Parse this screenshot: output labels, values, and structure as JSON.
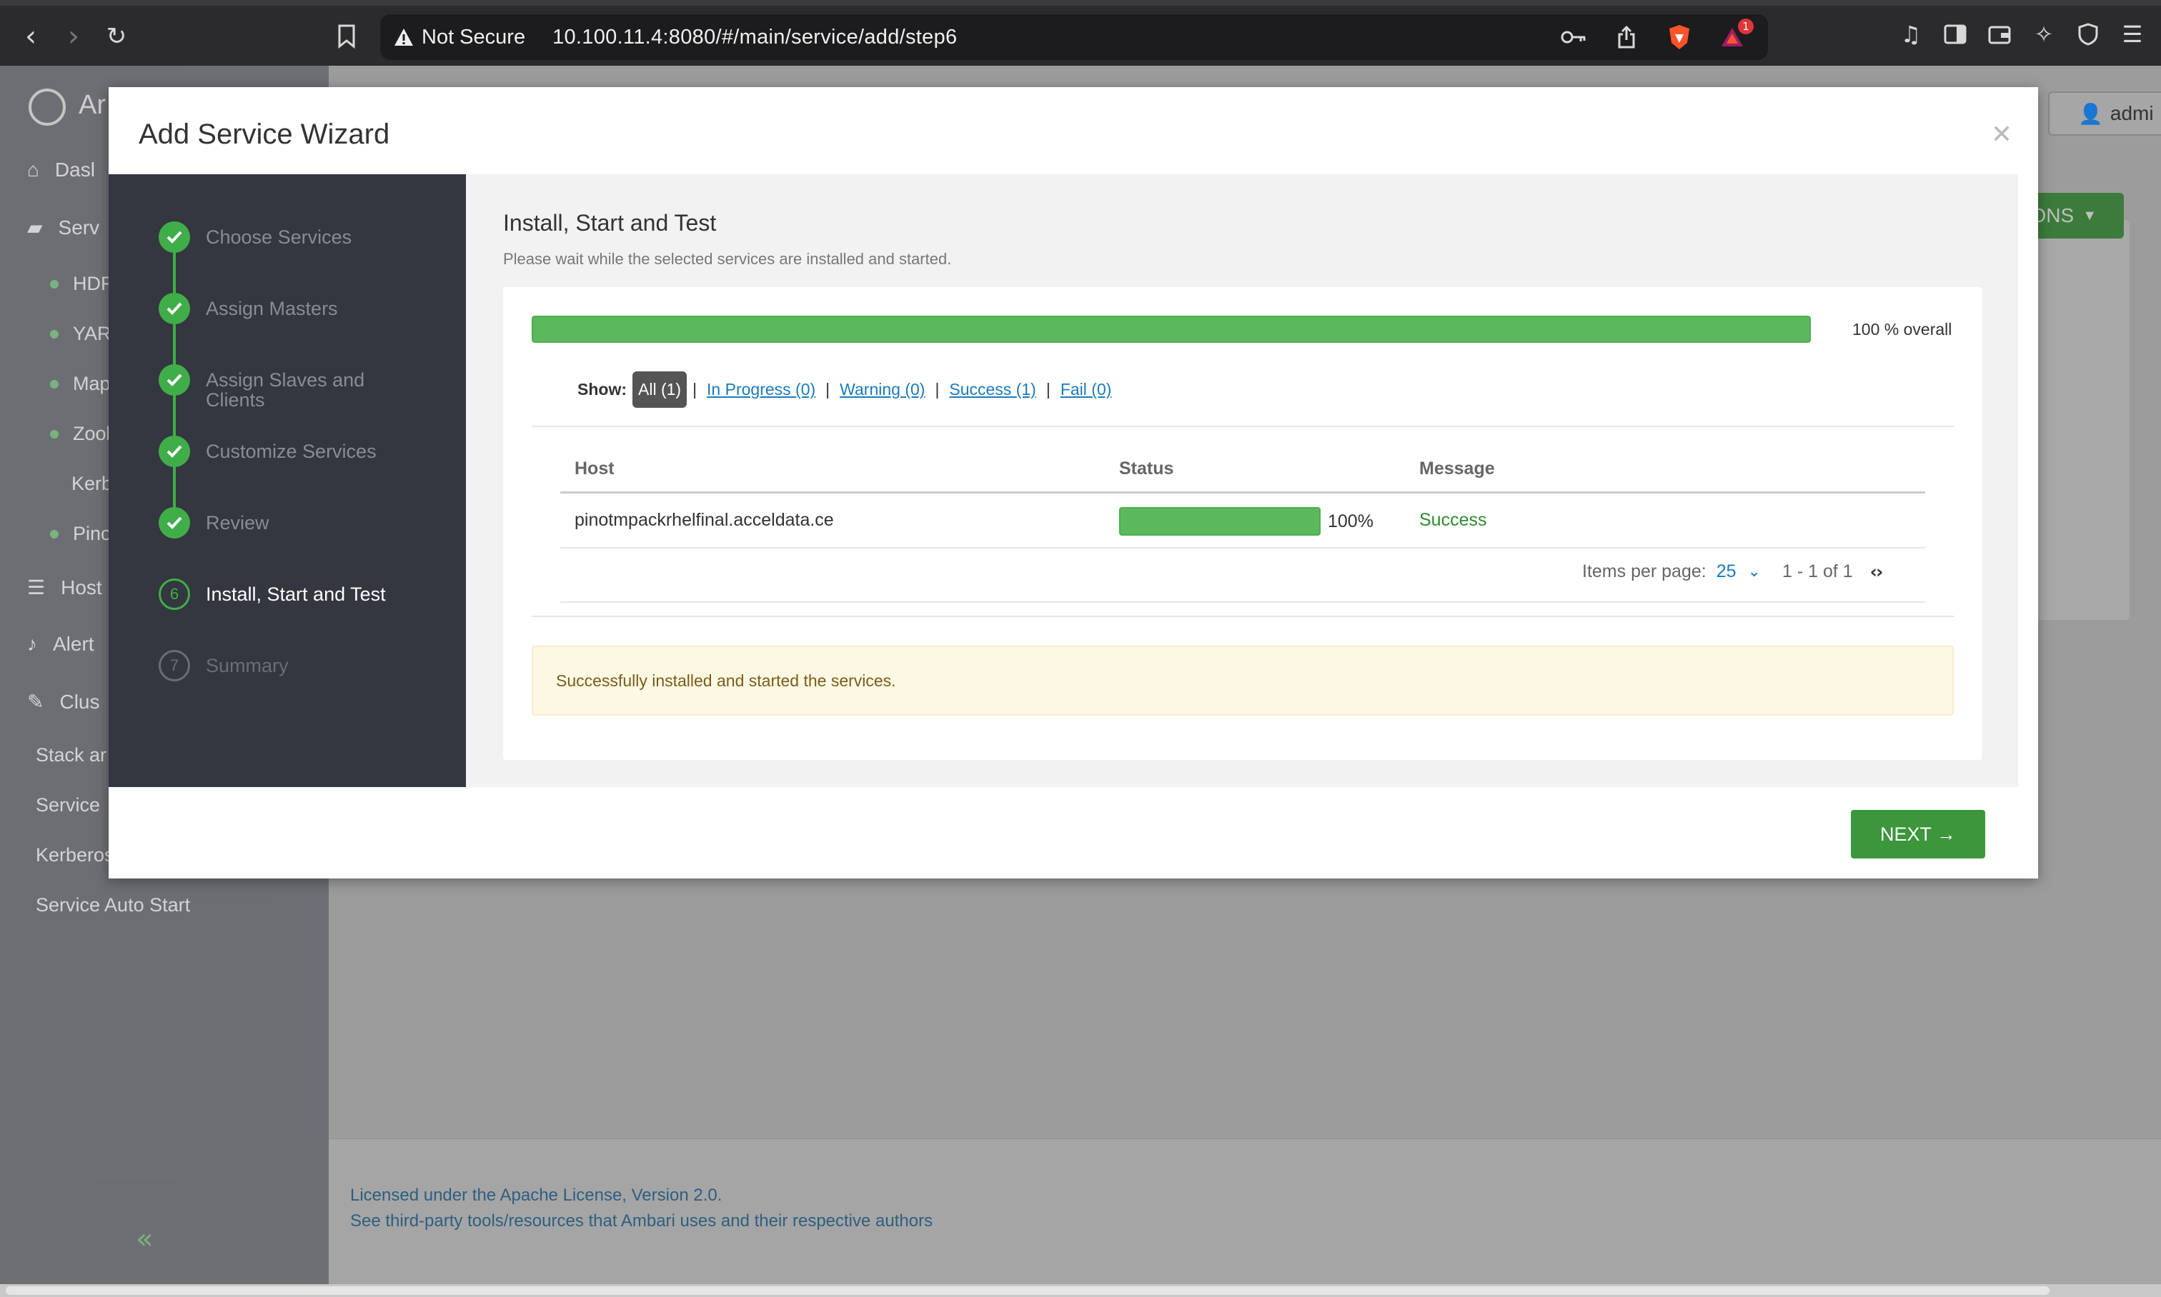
{
  "browser": {
    "not_secure": "Not Secure",
    "url": "10.100.11.4:8080/#/main/service/add/step6",
    "brave_badge": "1"
  },
  "app": {
    "brand": "Ar",
    "user_label": "admi",
    "actions_label": "ONS",
    "sidebar": {
      "dashboard": "Dasl",
      "services": "Serv",
      "service_items": [
        "HDF",
        "YARI",
        "Map",
        "Zool"
      ],
      "kerberos_sub": "Kerb",
      "pinot": "Pino",
      "hosts": "Host",
      "alerts": "Alert",
      "cluster": "Clus",
      "links": [
        "Stack ar",
        "Service",
        "Kerberos",
        "Service Auto Start"
      ]
    },
    "footer": {
      "license": "Licensed under the Apache License, Version 2.0.",
      "third_party": "See third-party tools/resources that Ambari uses and their respective authors"
    }
  },
  "wizard": {
    "title": "Add Service Wizard",
    "steps": [
      {
        "label": "Choose Services"
      },
      {
        "label": "Assign Masters"
      },
      {
        "label": "Assign Slaves and Clients"
      },
      {
        "label": "Customize Services"
      },
      {
        "label": "Review"
      },
      {
        "label": "Install, Start and Test",
        "number": "6"
      },
      {
        "label": "Summary",
        "number": "7"
      }
    ],
    "content": {
      "title": "Install, Start and Test",
      "subtitle": "Please wait while the selected services are installed and started.",
      "overall_progress": 100,
      "overall_text": "100 % overall",
      "filter": {
        "show_label": "Show:",
        "all": "All (1)",
        "in_progress": "In Progress (0)",
        "warning": "Warning (0)",
        "success": "Success (1)",
        "fail": "Fail (0)"
      },
      "table": {
        "headers": {
          "host": "Host",
          "status": "Status",
          "message": "Message"
        },
        "rows": [
          {
            "host": "pinotmpackrhelfinal.acceldata.ce",
            "progress": 100,
            "percent": "100%",
            "message": "Success"
          }
        ]
      },
      "pager": {
        "items_per_page_label": "Items per page:",
        "items_per_page": "25",
        "range": "1 - 1 of 1"
      },
      "alert": "Successfully installed and started the services."
    },
    "next_label": "NEXT →"
  }
}
